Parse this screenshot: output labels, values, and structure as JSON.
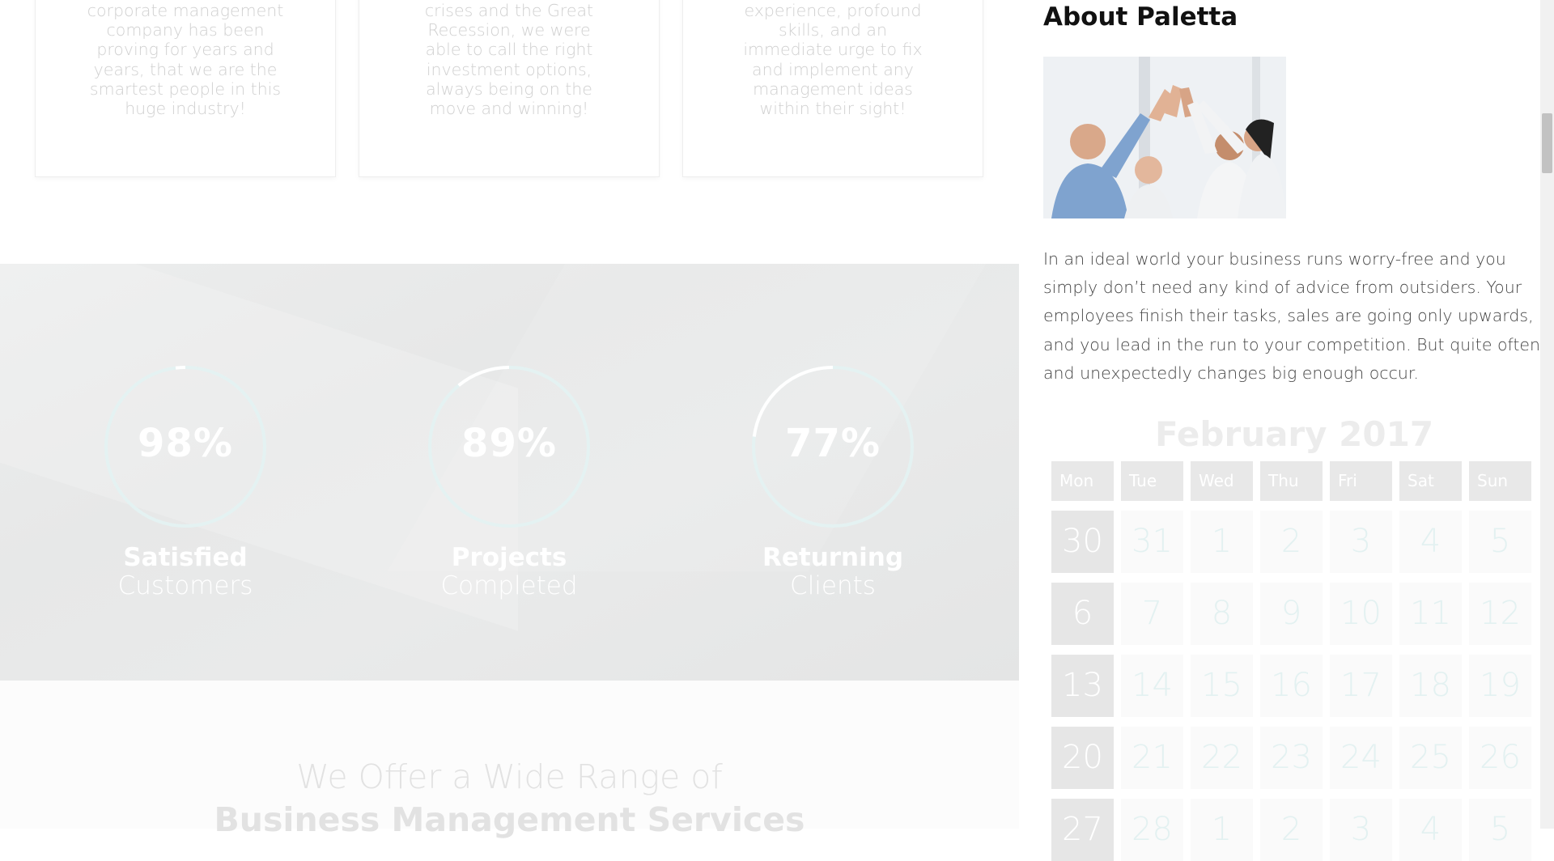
{
  "cards": [
    {
      "text": "corporate management company has been proving for years and years, that we are the smartest people in this huge industry!"
    },
    {
      "text": "crises and the Great Recession, we were able to call the right investment options, always being on the move and winning!"
    },
    {
      "text": "experience, profound skills, and an immediate urge to fix and implement any management ideas within their sight!"
    }
  ],
  "stats": [
    {
      "percent": "98%",
      "value": 0.98,
      "label_bold": "Satisfied",
      "label_light": "Customers"
    },
    {
      "percent": "89%",
      "value": 0.89,
      "label_bold": "Projects",
      "label_light": "Completed"
    },
    {
      "percent": "77%",
      "value": 0.77,
      "label_bold": "Returning",
      "label_light": "Clients"
    }
  ],
  "offer": {
    "line1": "We Offer a Wide Range of",
    "line2": "Business Management Services"
  },
  "sidebar": {
    "title": "About Paletta",
    "text": "In an ideal world your business runs worry-free and you simply don’t need any kind of advice from outsiders. Your employees finish their tasks, sales are going only upwards, and you lead in the run to your competition. But quite often and unexpectedly changes big enough occur."
  },
  "calendar": {
    "title": "February 2017",
    "days": [
      "Mon",
      "Tue",
      "Wed",
      "Thu",
      "Fri",
      "Sat",
      "Sun"
    ],
    "weeks": [
      [
        "30",
        "31",
        "1",
        "2",
        "3",
        "4",
        "5"
      ],
      [
        "6",
        "7",
        "8",
        "9",
        "10",
        "11",
        "12"
      ],
      [
        "13",
        "14",
        "15",
        "16",
        "17",
        "18",
        "19"
      ],
      [
        "20",
        "21",
        "22",
        "23",
        "24",
        "25",
        "26"
      ],
      [
        "27",
        "28",
        "1",
        "2",
        "3",
        "4",
        "5"
      ]
    ],
    "highlighted": [
      "6",
      "13",
      "20",
      "27"
    ]
  },
  "colors": {
    "ring_track": "#e4f2f2",
    "ring_fill": "#ffffff",
    "stats_bg": "#e8e9e9"
  }
}
